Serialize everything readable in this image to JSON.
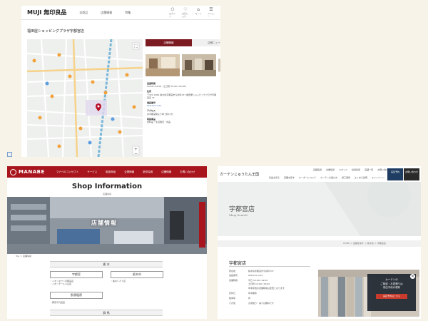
{
  "muji": {
    "logo": "MUJI 無印良品",
    "nav": [
      "全商品",
      "店舗情報",
      "特集"
    ],
    "icons": [
      {
        "name": "user-icon",
        "glyph": "⚇",
        "label": "ログイン"
      },
      {
        "name": "heart-icon",
        "glyph": "♡",
        "label": "お気に入り"
      },
      {
        "name": "cart-icon",
        "glyph": "⌂",
        "label": "カート"
      },
      {
        "name": "menu-icon",
        "glyph": "☰",
        "label": "メニュー"
      }
    ],
    "store_title": "福田屋ショッピングプラザ宇都宮店",
    "tab_active": "店舗情報",
    "tab_inactive": "店舗ニュース",
    "info": {
      "hours_label": "営業時間",
      "hours_value": "10:00～19:00（土日祝:10:00～20:00）",
      "address_label": "住所",
      "address_value": "〒321-0962 栃木県宇都宮市今泉町237 福田屋ショッピングプラザ宇都宮店 1F",
      "phone_label": "電話番号",
      "phone_value": "028-xxx-xxxx",
      "access_label": "アクセス",
      "access_value": "JR宇都宮駅より車で約15分",
      "services_label": "取扱商品",
      "services_value": "衣料品・生活雑貨・食品"
    },
    "map_pin_label": "福田屋ショッピングプラザ"
  },
  "manabe": {
    "logo": "MANABE",
    "nav": [
      "マナベのコンセプト",
      "サービス",
      "取扱商品",
      "企業情報",
      "新卒採用",
      "店舗情報",
      "お問い合わせ"
    ],
    "title": "Shop Information",
    "subtitle": "店舗情報",
    "hero_label": "店舗情報",
    "breadcrumb": "Top ＞ 店舗情報",
    "section1": "栃 木",
    "buttons": [
      "宇都宮",
      "栃木市",
      "那須塩原"
    ],
    "list1": [
      "・イオンタウン宇都宮店",
      "・イオンモール小山店"
    ],
    "list2": [
      "・栃木ＣＡＹ店"
    ],
    "list3": [
      "・那須千代田店"
    ],
    "section2": "群 馬"
  },
  "garden": {
    "logo": "カーテンじゅうたん王国",
    "nav_top": [
      "店舗情報",
      "企業情報",
      "スタッフ",
      "採用情報",
      "店舗一覧",
      "お問い合わせ"
    ],
    "nav_bottom": [
      "商品を見る",
      "店舗を探す",
      "オーダーについて",
      "カーテンの選び方",
      "施工事例",
      "よくある質問",
      "キャンペーン"
    ],
    "btn_reserve": "来店予約",
    "btn_contact": "お問い合わせ",
    "hero_title": "宇都宮店",
    "hero_sub": "Shop Search",
    "breadcrumb": "HOME ＞ 店舗を探す ＞ 栃木県 ＞ 宇都宮店",
    "store_name": "宇都宮店",
    "rows": [
      {
        "k": "所在地",
        "v": "栃木県宇都宮市今泉町237"
      },
      {
        "k": "電話番号",
        "v": "028-xxx-xxxx"
      },
      {
        "k": "営業時間",
        "v": "平日 10:00～19:00"
      },
      {
        "k": "",
        "v": "土日祝 10:00～19:00"
      },
      {
        "k": "",
        "v": "年末年始の営業時間は変更となります"
      },
      {
        "k": "定休日",
        "v": "年中無休"
      },
      {
        "k": "駐車場",
        "v": "有"
      },
      {
        "k": "その他",
        "v": "お見積り・採寸は無料です"
      }
    ],
    "popup_title": "カーテンの",
    "popup_line2": "ご相談・お見積りは",
    "popup_line3": "来店予約が便利",
    "popup_btn": "来店予約はこちら"
  }
}
